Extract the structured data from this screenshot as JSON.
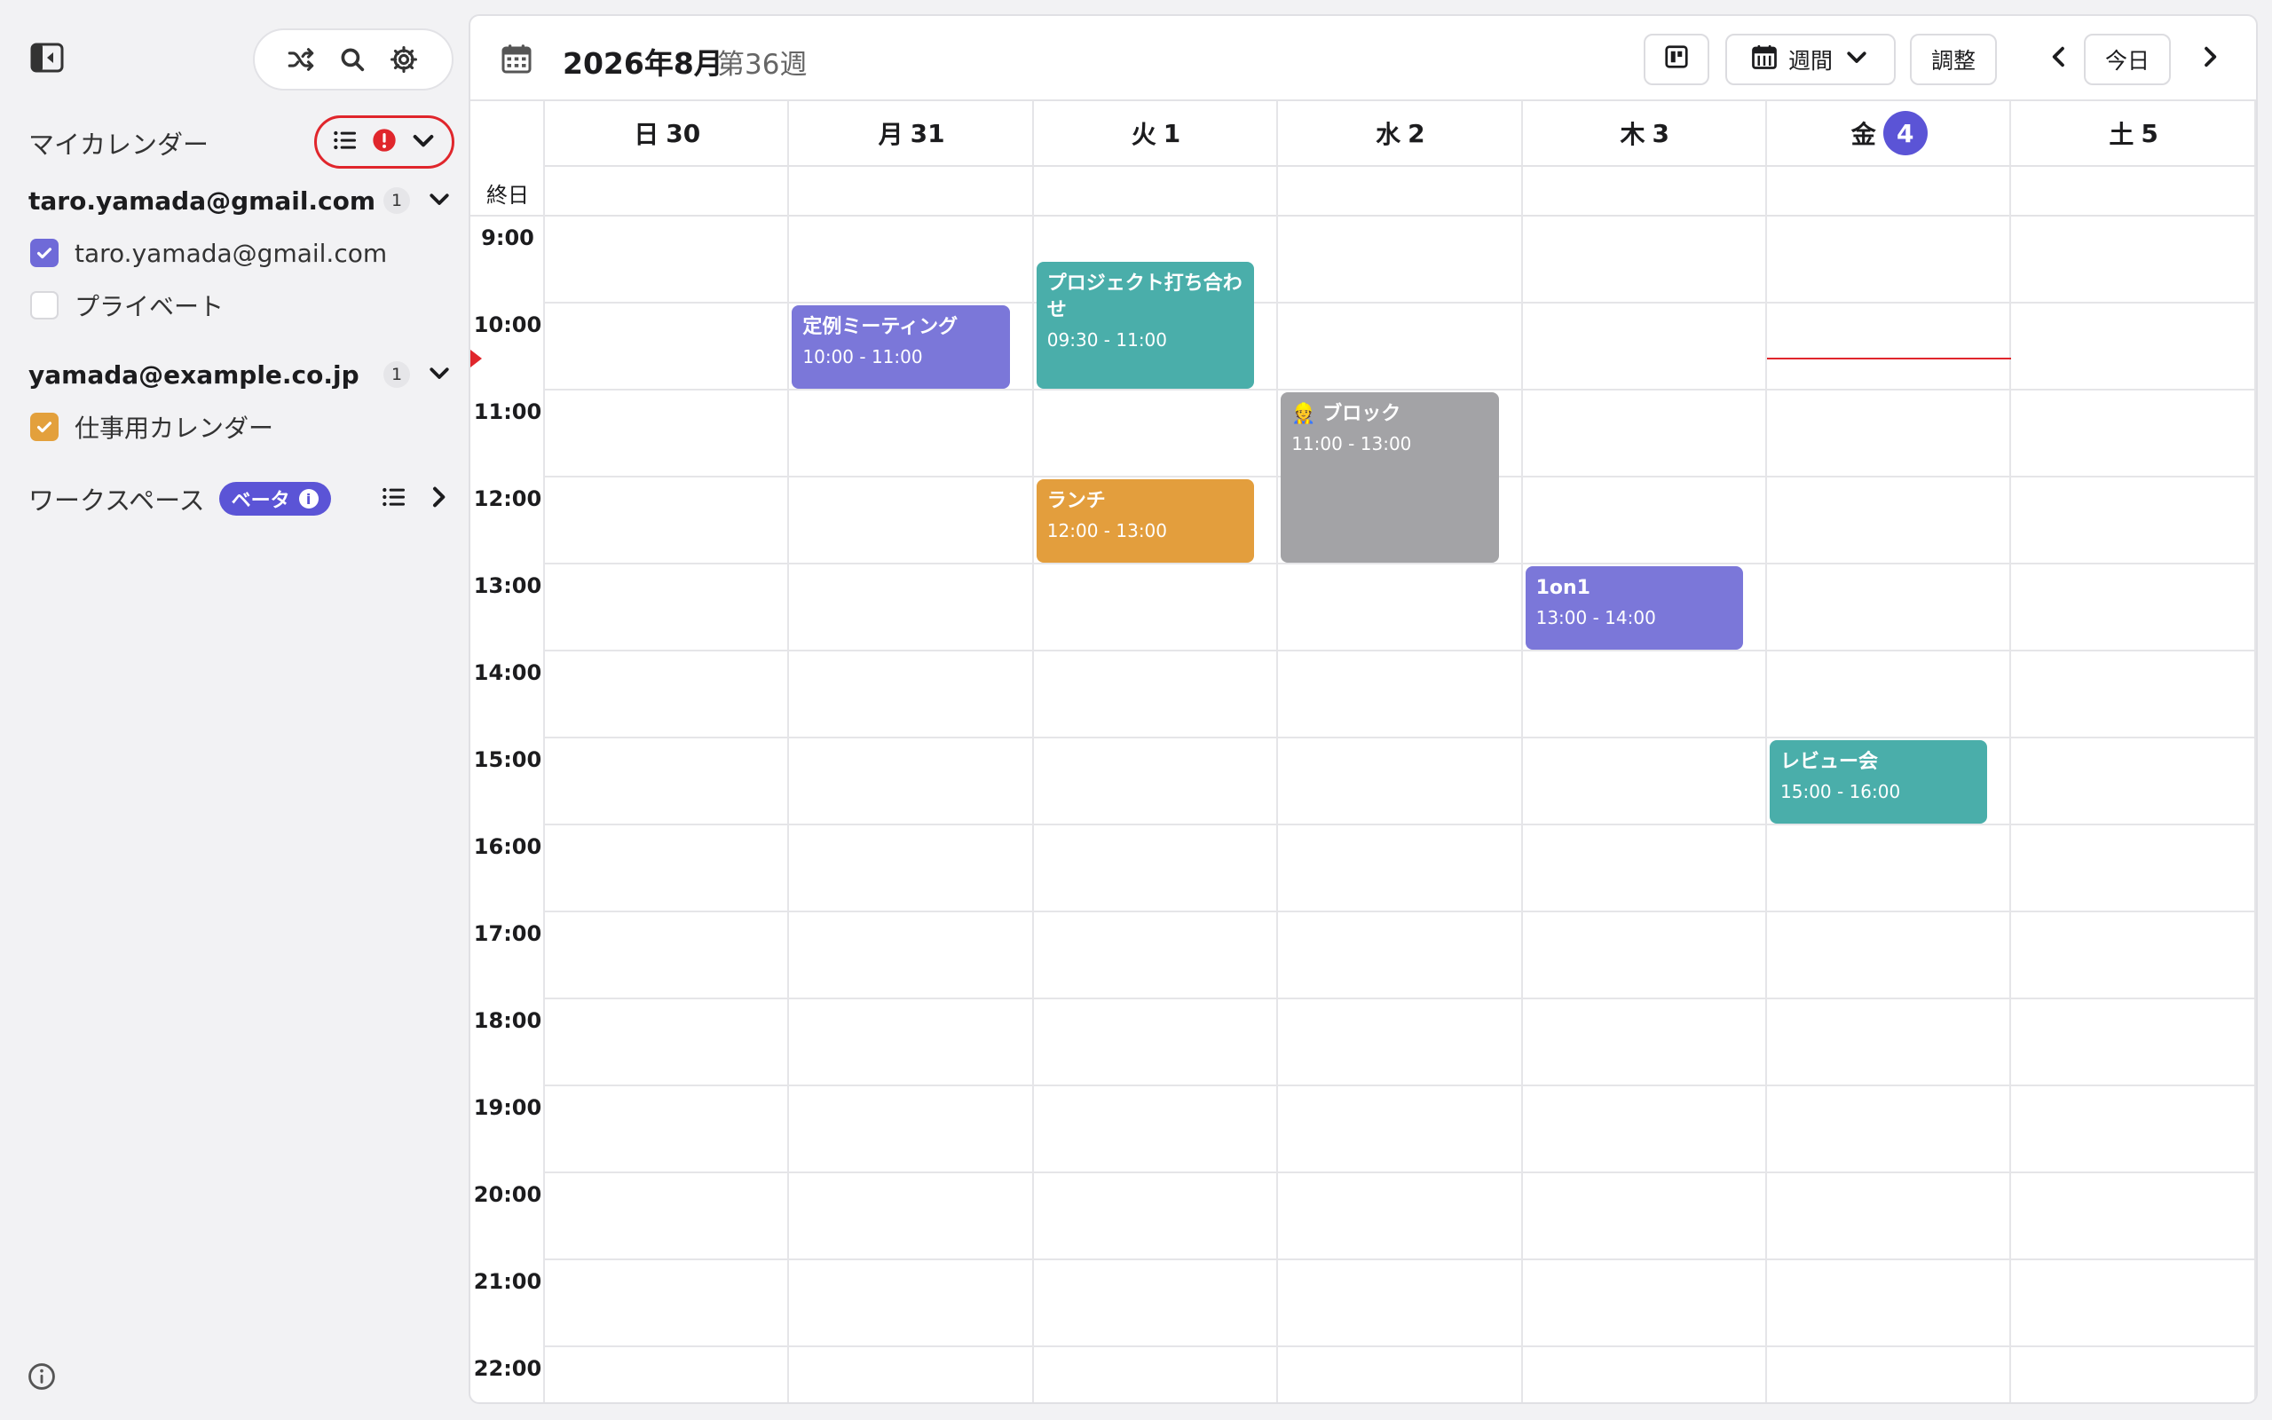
{
  "sidebar": {
    "toggle_icon": "sidebar-toggle-icon",
    "tools": [
      "shuffle-icon",
      "search-icon",
      "gear-icon"
    ],
    "my_calendars": {
      "title": "マイカレンダー",
      "tools": [
        "list-icon",
        "alert-icon",
        "chevron-down-icon"
      ]
    },
    "accounts": [
      {
        "name": "taro.yamada@gmail.com",
        "count": "1",
        "calendars": [
          {
            "label": "taro.yamada@gmail.com",
            "checked": true,
            "color": "#6f6ad8"
          },
          {
            "label": "プライベート",
            "checked": false,
            "color": "#ffffff"
          }
        ]
      },
      {
        "name": "yamada@example.co.jp",
        "count": "1",
        "calendars": [
          {
            "label": "仕事用カレンダー",
            "checked": true,
            "color": "#e3a03c"
          }
        ]
      }
    ],
    "workspace": {
      "label": "ワークスペース",
      "badge": "ベータ",
      "badge_icon": "info-icon"
    }
  },
  "toolbar": {
    "title": "2026年8月",
    "week": "第36週",
    "view_label": "週間",
    "adjust_label": "調整",
    "today_label": "今日"
  },
  "days": [
    {
      "weekday": "日",
      "date": "30",
      "today": false
    },
    {
      "weekday": "月",
      "date": "31",
      "today": false
    },
    {
      "weekday": "火",
      "date": "1",
      "today": false
    },
    {
      "weekday": "水",
      "date": "2",
      "today": false
    },
    {
      "weekday": "木",
      "date": "3",
      "today": false
    },
    {
      "weekday": "金",
      "date": "4",
      "today": true
    },
    {
      "weekday": "土",
      "date": "5",
      "today": false
    }
  ],
  "allday_label": "終日",
  "hours": [
    "9:00",
    "10:00",
    "11:00",
    "12:00",
    "13:00",
    "14:00",
    "15:00",
    "16:00",
    "17:00",
    "18:00",
    "19:00",
    "20:00",
    "21:00",
    "22:00"
  ],
  "events": [
    {
      "title": "定例ミーティング",
      "time": "10:00 - 11:00",
      "day": 1,
      "start": 10.0,
      "end": 11.0,
      "color": "#7b77d9"
    },
    {
      "title": "プロジェクト打ち合わせ",
      "time": "09:30 - 11:00",
      "day": 2,
      "start": 9.5,
      "end": 11.0,
      "color": "#4aaeaa"
    },
    {
      "title": "👷 ブロック",
      "time": "11:00 - 13:00",
      "day": 3,
      "start": 11.0,
      "end": 13.0,
      "color": "#a3a3a6"
    },
    {
      "title": "ランチ",
      "time": "12:00 - 13:00",
      "day": 2,
      "start": 12.0,
      "end": 13.0,
      "color": "#e39e3d"
    },
    {
      "title": "1on1",
      "time": "13:00 - 14:00",
      "day": 4,
      "start": 13.0,
      "end": 14.0,
      "color": "#7b77d9"
    },
    {
      "title": "レビュー会",
      "time": "15:00 - 16:00",
      "day": 5,
      "start": 15.0,
      "end": 16.0,
      "color": "#4aaeaa"
    }
  ],
  "now": {
    "day": 5,
    "hour": 10.62
  }
}
